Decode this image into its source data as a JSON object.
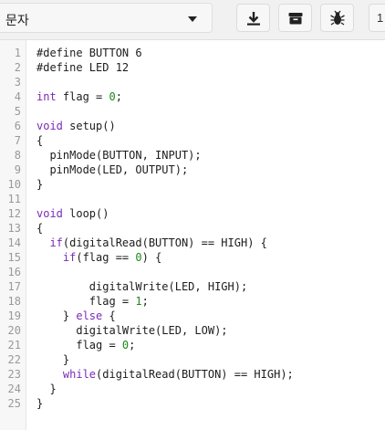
{
  "toolbar": {
    "language_select": {
      "value": "문자"
    },
    "buttons": [
      {
        "icon": "download-icon"
      },
      {
        "icon": "archive-box-icon"
      },
      {
        "icon": "bug-icon"
      }
    ],
    "partial_button_text": "1"
  },
  "editor": {
    "lines": [
      {
        "n": "1",
        "tokens": [
          {
            "t": "#define BUTTON 6",
            "c": ""
          }
        ]
      },
      {
        "n": "2",
        "tokens": [
          {
            "t": "#define LED 12",
            "c": ""
          }
        ]
      },
      {
        "n": "3",
        "tokens": []
      },
      {
        "n": "4",
        "tokens": [
          {
            "t": "int",
            "c": "kw"
          },
          {
            "t": " flag = ",
            "c": ""
          },
          {
            "t": "0",
            "c": "num"
          },
          {
            "t": ";",
            "c": ""
          }
        ]
      },
      {
        "n": "5",
        "tokens": []
      },
      {
        "n": "6",
        "tokens": [
          {
            "t": "void",
            "c": "kw"
          },
          {
            "t": " setup()",
            "c": ""
          }
        ]
      },
      {
        "n": "7",
        "tokens": [
          {
            "t": "{",
            "c": ""
          }
        ]
      },
      {
        "n": "8",
        "tokens": [
          {
            "t": "  pinMode(BUTTON, INPUT);",
            "c": ""
          }
        ]
      },
      {
        "n": "9",
        "tokens": [
          {
            "t": "  pinMode(LED, OUTPUT);",
            "c": ""
          }
        ]
      },
      {
        "n": "10",
        "tokens": [
          {
            "t": "}",
            "c": ""
          }
        ]
      },
      {
        "n": "11",
        "tokens": []
      },
      {
        "n": "12",
        "tokens": [
          {
            "t": "void",
            "c": "kw"
          },
          {
            "t": " loop()",
            "c": ""
          }
        ]
      },
      {
        "n": "13",
        "tokens": [
          {
            "t": "{",
            "c": ""
          }
        ]
      },
      {
        "n": "14",
        "tokens": [
          {
            "t": "  ",
            "c": ""
          },
          {
            "t": "if",
            "c": "kw"
          },
          {
            "t": "(digitalRead(BUTTON) == HIGH) {",
            "c": ""
          }
        ]
      },
      {
        "n": "15",
        "tokens": [
          {
            "t": "    ",
            "c": ""
          },
          {
            "t": "if",
            "c": "kw"
          },
          {
            "t": "(flag == ",
            "c": ""
          },
          {
            "t": "0",
            "c": "num"
          },
          {
            "t": ") {",
            "c": ""
          }
        ]
      },
      {
        "n": "16",
        "tokens": []
      },
      {
        "n": "17",
        "tokens": [
          {
            "t": "        digitalWrite(LED, HIGH);",
            "c": ""
          }
        ]
      },
      {
        "n": "18",
        "tokens": [
          {
            "t": "        flag = ",
            "c": ""
          },
          {
            "t": "1",
            "c": "num"
          },
          {
            "t": ";",
            "c": ""
          }
        ]
      },
      {
        "n": "19",
        "tokens": [
          {
            "t": "    } ",
            "c": ""
          },
          {
            "t": "else",
            "c": "kw"
          },
          {
            "t": " {",
            "c": ""
          }
        ]
      },
      {
        "n": "20",
        "tokens": [
          {
            "t": "      digitalWrite(LED, LOW);",
            "c": ""
          }
        ]
      },
      {
        "n": "21",
        "tokens": [
          {
            "t": "      flag = ",
            "c": ""
          },
          {
            "t": "0",
            "c": "num"
          },
          {
            "t": ";",
            "c": ""
          }
        ]
      },
      {
        "n": "22",
        "tokens": [
          {
            "t": "    }",
            "c": ""
          }
        ]
      },
      {
        "n": "23",
        "tokens": [
          {
            "t": "    ",
            "c": ""
          },
          {
            "t": "while",
            "c": "kw"
          },
          {
            "t": "(digitalRead(BUTTON) == HIGH);",
            "c": ""
          }
        ]
      },
      {
        "n": "24",
        "tokens": [
          {
            "t": "  }",
            "c": ""
          }
        ]
      },
      {
        "n": "25",
        "tokens": [
          {
            "t": "}",
            "c": ""
          }
        ]
      }
    ]
  },
  "colors": {
    "keyword": "#7a2ab5",
    "number": "#1a8a1a",
    "text": "#1c1c1c",
    "line_number": "#999999"
  }
}
